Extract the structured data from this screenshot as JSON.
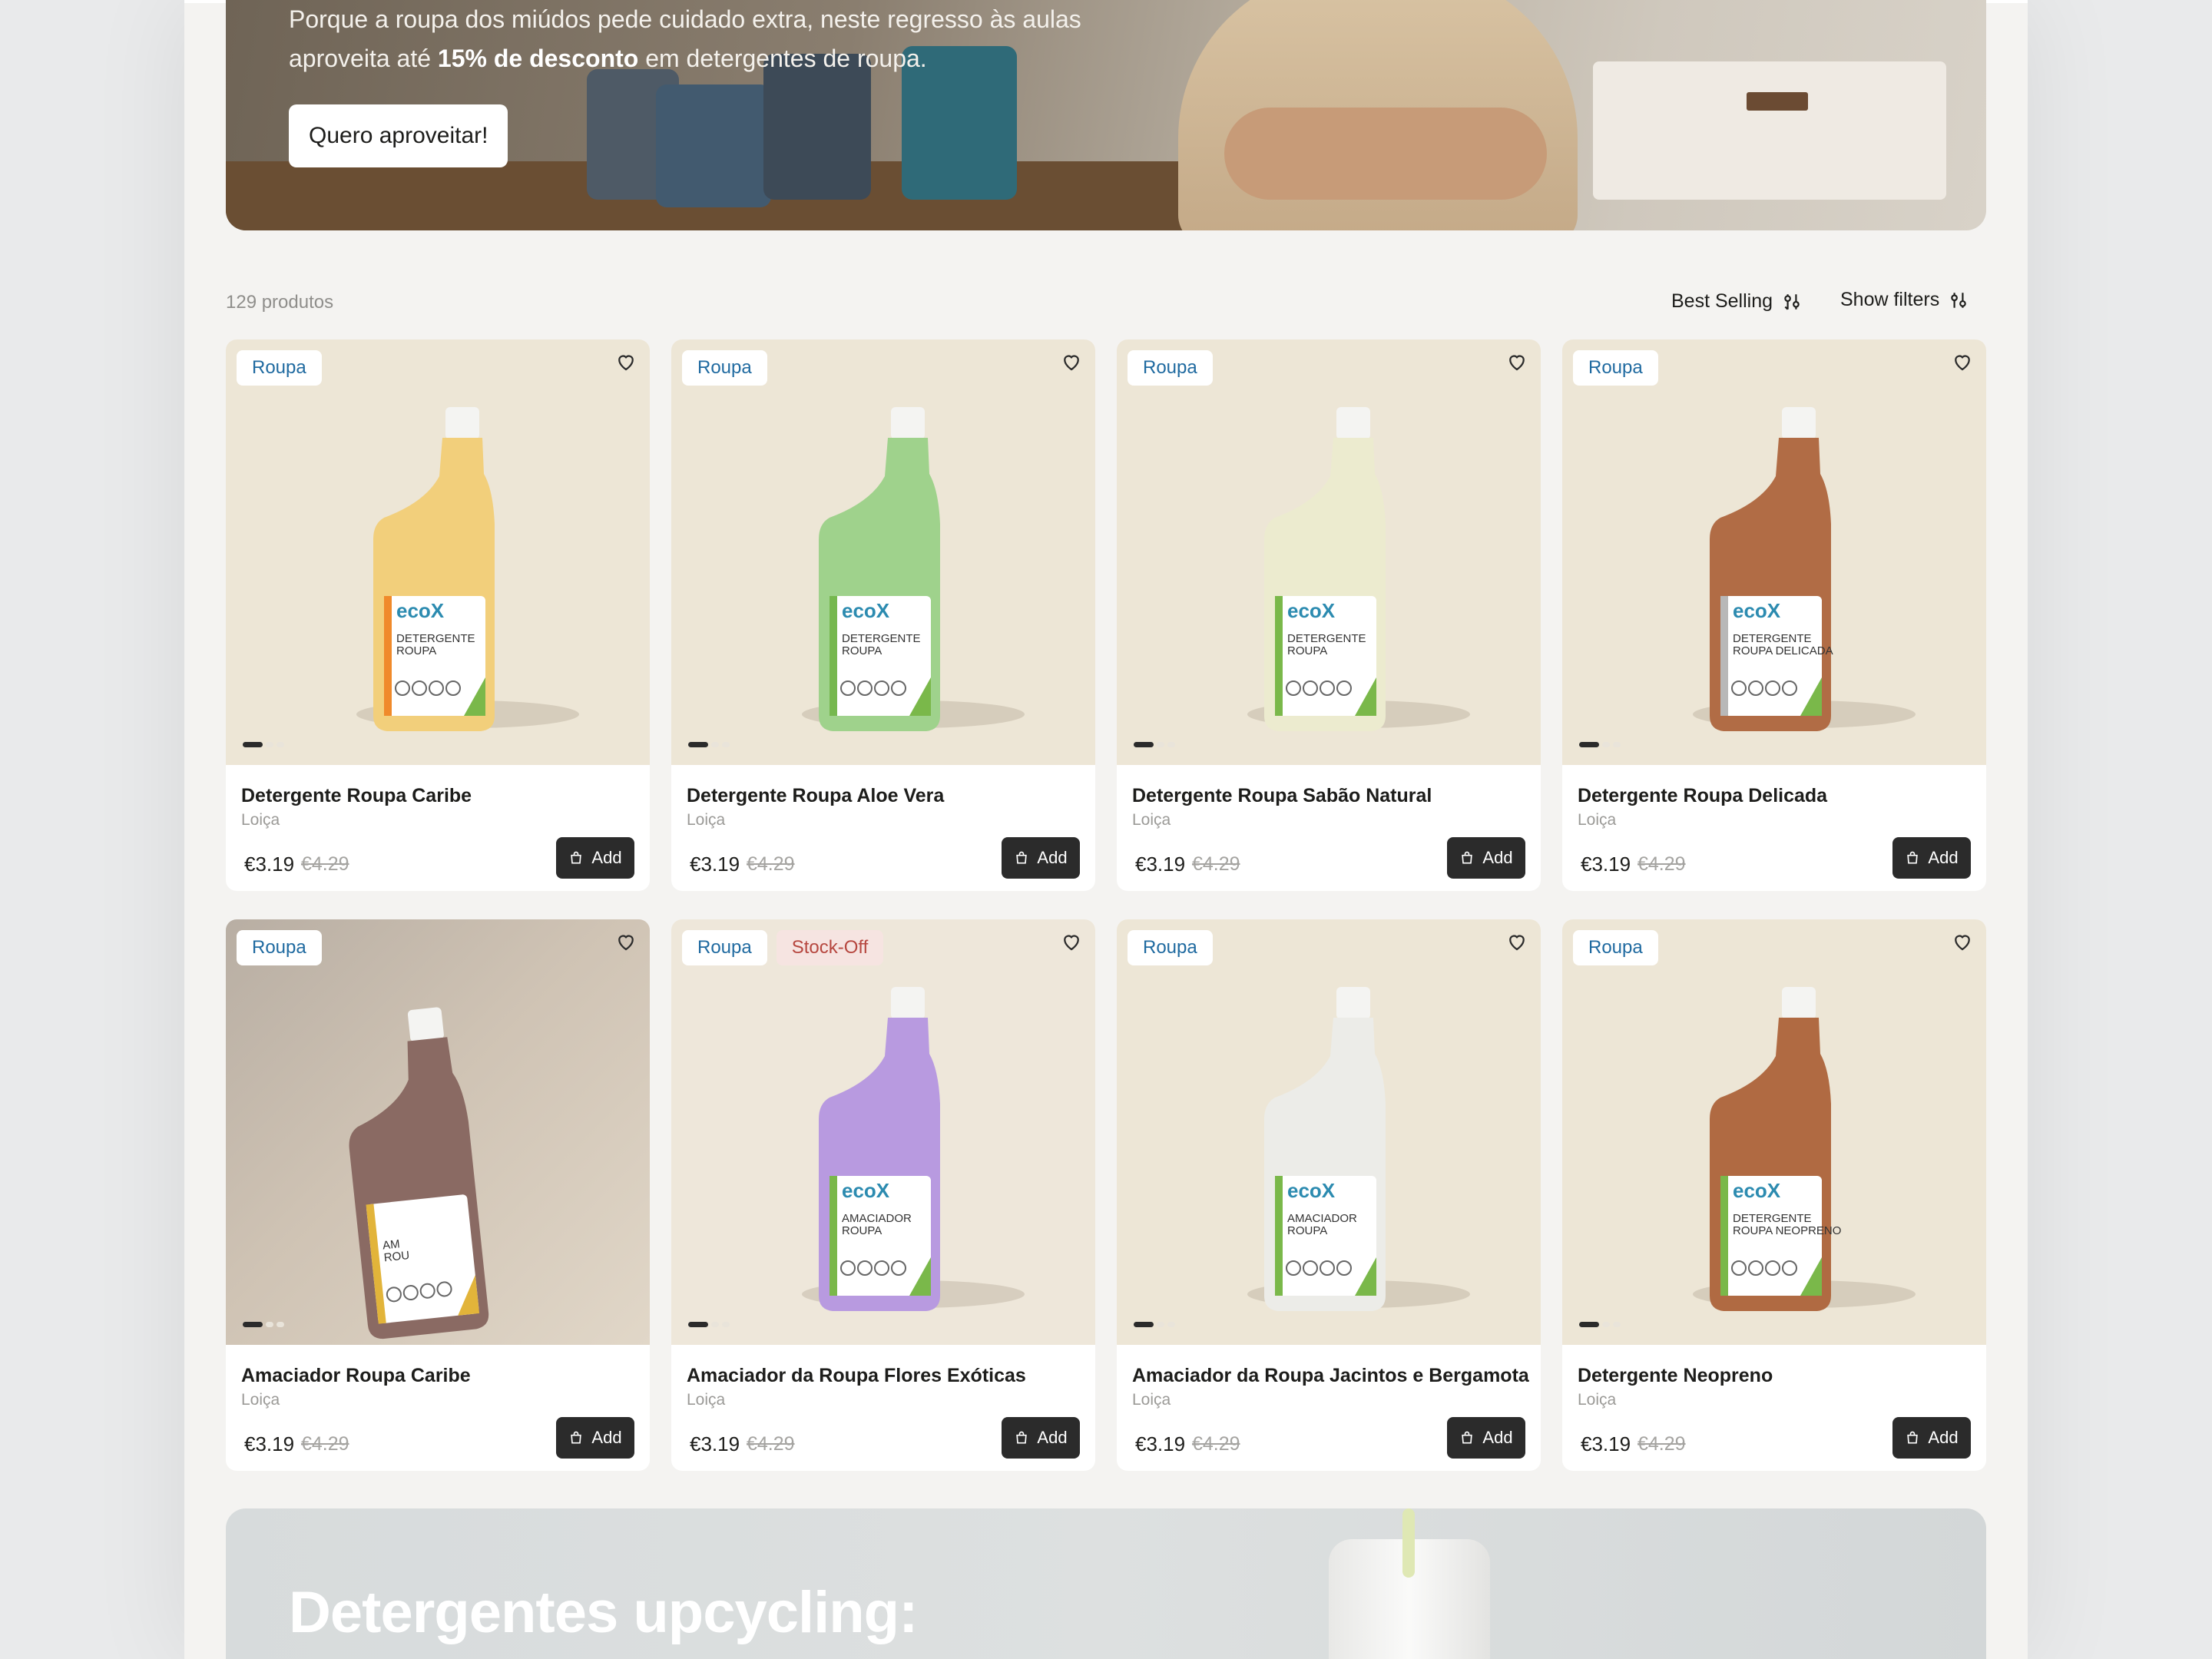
{
  "hero": {
    "text_before": "Porque a roupa dos miúdos pede cuidado extra, neste regresso às aulas aproveita até ",
    "text_bold": "15% de desconto",
    "text_after": " em detergentes de roupa.",
    "cta_label": "Quero aproveitar!"
  },
  "toolbar": {
    "count": "129 produtos",
    "sort_label": "Best Selling",
    "filters_label": "Show filters"
  },
  "products": [
    {
      "name": "Detergente Roupa Caribe",
      "category": "Loiça",
      "price": "€3.19",
      "old_price": "€4.29",
      "badges": [
        "Roupa"
      ],
      "add_label": "Add",
      "liquid": "#f2cf7b",
      "accent": "#f08a2a"
    },
    {
      "name": "Detergente Roupa Aloe Vera",
      "category": "Loiça",
      "price": "€3.19",
      "old_price": "€4.29",
      "badges": [
        "Roupa"
      ],
      "add_label": "Add",
      "liquid": "#9fd28c",
      "accent": "#76b84f"
    },
    {
      "name": "Detergente Roupa Sabão Natural",
      "category": "Loiça",
      "price": "€3.19",
      "old_price": "€4.29",
      "badges": [
        "Roupa"
      ],
      "add_label": "Add",
      "liquid": "#ecebcf",
      "accent": "#7ab84a"
    },
    {
      "name": "Detergente Roupa Delicada",
      "category": "Loiça",
      "price": "€3.19",
      "old_price": "€4.29",
      "badges": [
        "Roupa"
      ],
      "add_label": "Add",
      "liquid": "#b16c45",
      "accent": "#b8b8b8"
    },
    {
      "name": "Amaciador Roupa Caribe",
      "category": "Loiça",
      "price": "€3.19",
      "old_price": "€4.29",
      "badges": [
        "Roupa"
      ],
      "add_label": "Add",
      "liquid": "#8a6a63",
      "accent": "#e2b43a"
    },
    {
      "name": "Amaciador da Roupa Flores Exóticas",
      "category": "Loiça",
      "price": "€3.19",
      "old_price": "€4.29",
      "badges": [
        "Roupa",
        "Stock-Off"
      ],
      "add_label": "Add",
      "liquid": "#b89ae0",
      "accent": "#7ab84a"
    },
    {
      "name": "Amaciador da Roupa Jacintos e Bergamota",
      "category": "Loiça",
      "price": "€3.19",
      "old_price": "€4.29",
      "badges": [
        "Roupa"
      ],
      "add_label": "Add",
      "liquid": "#ecece8",
      "accent": "#7ab84a"
    },
    {
      "name": "Detergente Neopreno",
      "category": "Loiça",
      "price": "€3.19",
      "old_price": "€4.29",
      "badges": [
        "Roupa"
      ],
      "add_label": "Add",
      "liquid": "#b06a42",
      "accent": "#7ab84a"
    }
  ],
  "labels": [
    {
      "brand": "ecoX",
      "line1": "DETERGENTE",
      "line2": "ROUPA"
    },
    {
      "brand": "ecoX",
      "line1": "DETERGENTE",
      "line2": "ROUPA"
    },
    {
      "brand": "ecoX",
      "line1": "DETERGENTE",
      "line2": "ROUPA"
    },
    {
      "brand": "ecoX",
      "line1": "DETERGENTE",
      "line2": "ROUPA DELICADA"
    },
    {
      "brand": "",
      "line1": "AM",
      "line2": "ROU"
    },
    {
      "brand": "ecoX",
      "line1": "AMACIADOR",
      "line2": "ROUPA"
    },
    {
      "brand": "ecoX",
      "line1": "AMACIADOR",
      "line2": "ROUPA"
    },
    {
      "brand": "ecoX",
      "line1": "DETERGENTE",
      "line2": "ROUPA NEOPRENO"
    }
  ],
  "banner": {
    "title": "Detergentes upcycling:"
  },
  "icons": {
    "heart": "heart-icon",
    "bag": "shopping-bag-icon",
    "sort": "sort-icon",
    "filter": "filter-icon"
  }
}
